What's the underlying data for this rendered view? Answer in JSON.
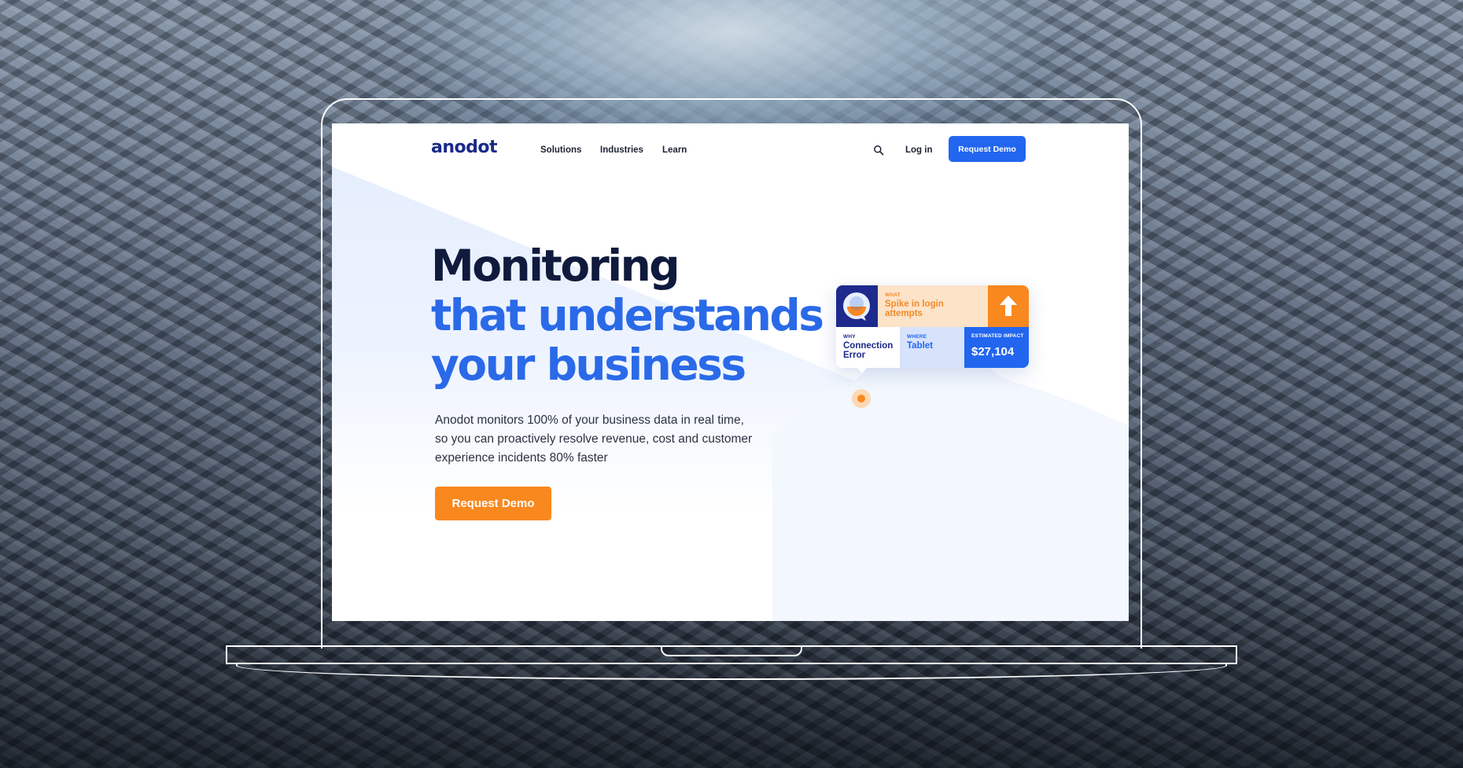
{
  "brand": {
    "logo_text": "anodot"
  },
  "nav": {
    "items": [
      {
        "label": "Solutions"
      },
      {
        "label": "Industries"
      },
      {
        "label": "Learn"
      }
    ],
    "search_icon": "search-icon",
    "login_label": "Log in",
    "cta_label": "Request Demo"
  },
  "hero": {
    "title_line1": "Monitoring",
    "title_line2": "that understands",
    "title_line3": "your business",
    "description_line1": "Anodot monitors 100% of your business data in real time,",
    "description_line2": "so you can proactively resolve revenue, cost and customer",
    "description_line3": "experience incidents 80% faster",
    "cta_label": "Request Demo"
  },
  "alert_card": {
    "what_label": "WHAT",
    "what_value": "Spike in login attempts",
    "why_label": "WHY",
    "why_value": "Connection Error",
    "where_label": "WHERE",
    "where_value": "Tablet",
    "impact_label": "ESTIMATED IMPACT",
    "impact_value": "$27,104",
    "arrow_icon": "arrow-up-icon",
    "avatar_icon": "avatar-icon"
  },
  "colors": {
    "brand_navy": "#1d2a8c",
    "brand_blue": "#2266f0",
    "accent_orange": "#f9881f",
    "heading_dark": "#101a3d"
  }
}
